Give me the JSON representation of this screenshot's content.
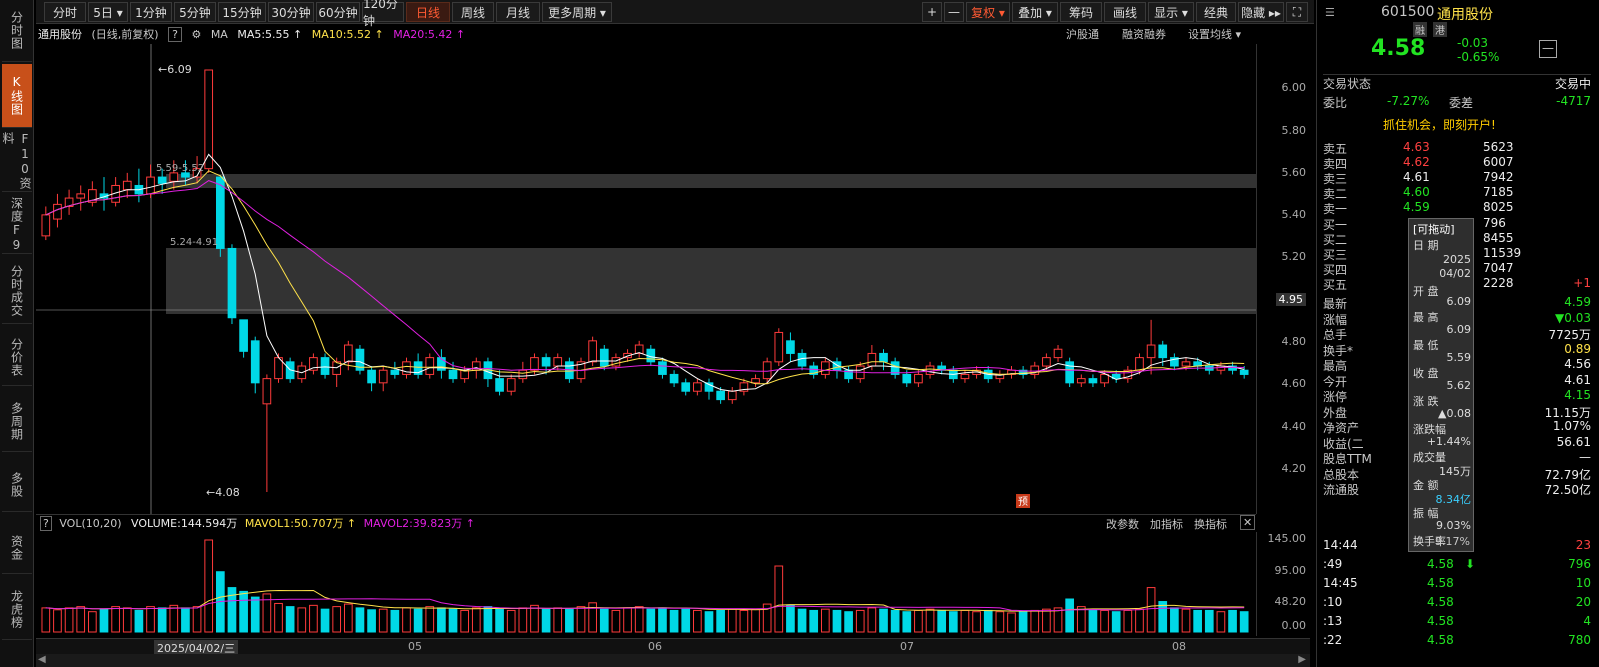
{
  "left_tabs": [
    "分时图",
    "K线图",
    "F10资料",
    "深度F9",
    "分时成交",
    "分价表",
    "多周期",
    "多股",
    "资金",
    "龙虎榜"
  ],
  "period_tabs": [
    {
      "label": "分时"
    },
    {
      "label": "5日 ▾"
    },
    {
      "label": "1分钟"
    },
    {
      "label": "5分钟"
    },
    {
      "label": "15分钟"
    },
    {
      "label": "30分钟"
    },
    {
      "label": "60分钟"
    },
    {
      "label": "120分钟"
    },
    {
      "label": "日线"
    },
    {
      "label": "周线"
    },
    {
      "label": "月线"
    },
    {
      "label": "更多周期 ▾"
    }
  ],
  "tools": [
    {
      "label": "+"
    },
    {
      "label": "—"
    },
    {
      "label": "复权 ▾"
    },
    {
      "label": "叠加 ▾"
    },
    {
      "label": "筹码"
    },
    {
      "label": "画线"
    },
    {
      "label": "显示 ▾"
    },
    {
      "label": "经典"
    },
    {
      "label": "隐藏 ▸▸"
    }
  ],
  "chart_header": {
    "name": "通用股份",
    "period": "(日线,前复权)",
    "help": "?",
    "ma_label": "MA",
    "ma5": "MA5:5.55 ↑",
    "ma10": "MA10:5.52 ↑",
    "ma20": "MA20:5.42 ↑",
    "link1": "沪股通",
    "link2": "融资融券",
    "link3": "设置均线 ▾"
  },
  "price_annotations": {
    "high": "6.09",
    "low": "4.08",
    "zone1": "5.59-5.52",
    "zone2": "5.24-4.91",
    "current": "4.95",
    "badge": "预"
  },
  "price_ticks": [
    "6.00",
    "5.80",
    "5.60",
    "5.40",
    "5.20",
    "5.00",
    "4.80",
    "4.60",
    "4.40",
    "4.20"
  ],
  "volume_header": {
    "vol": "VOL(10,20)",
    "volume": "VOLUME:144.594万",
    "mavol1": "MAVOL1:50.707万 ↑",
    "mavol2": "MAVOL2:39.823万 ↑",
    "b1": "改参数",
    "b2": "加指标",
    "b3": "换指标"
  },
  "volume_ticks": [
    "145.00",
    "95.00",
    "48.20",
    "0.00"
  ],
  "date_labels": [
    "2025/04/02/三",
    "05",
    "06",
    "07",
    "08"
  ],
  "colors": {
    "up": "#ff3b3b",
    "down": "#00d8e6",
    "ma5": "#ffffff",
    "ma10": "#ffe24a",
    "ma20": "#e020e0",
    "accent": "#ff5a33"
  },
  "chart_data": {
    "type": "candlestick",
    "ylim": [
      4.08,
      6.09
    ],
    "candles": [
      [
        5.3,
        5.4,
        5.28,
        5.44
      ],
      [
        5.38,
        5.45,
        5.34,
        5.5
      ],
      [
        5.44,
        5.48,
        5.4,
        5.52
      ],
      [
        5.48,
        5.5,
        5.42,
        5.54
      ],
      [
        5.46,
        5.52,
        5.44,
        5.56
      ],
      [
        5.5,
        5.48,
        5.42,
        5.58
      ],
      [
        5.46,
        5.54,
        5.44,
        5.58
      ],
      [
        5.52,
        5.56,
        5.48,
        5.6
      ],
      [
        5.54,
        5.5,
        5.46,
        5.62
      ],
      [
        5.5,
        5.58,
        5.48,
        5.64
      ],
      [
        5.58,
        5.55,
        5.5,
        5.62
      ],
      [
        5.56,
        5.6,
        5.52,
        5.66
      ],
      [
        5.6,
        5.58,
        5.54,
        5.66
      ],
      [
        5.58,
        5.62,
        5.55,
        5.68
      ],
      [
        5.62,
        6.09,
        5.6,
        6.09
      ],
      [
        5.58,
        5.24,
        5.2,
        5.59
      ],
      [
        5.24,
        4.91,
        4.88,
        5.26
      ],
      [
        4.9,
        4.75,
        4.72,
        4.9
      ],
      [
        4.8,
        4.6,
        4.55,
        4.82
      ],
      [
        4.5,
        4.62,
        4.08,
        4.64
      ],
      [
        4.62,
        4.72,
        4.6,
        4.74
      ],
      [
        4.7,
        4.62,
        4.6,
        4.72
      ],
      [
        4.62,
        4.68,
        4.6,
        4.7
      ],
      [
        4.66,
        4.72,
        4.64,
        4.74
      ],
      [
        4.72,
        4.64,
        4.62,
        4.74
      ],
      [
        4.64,
        4.7,
        4.58,
        4.72
      ],
      [
        4.7,
        4.78,
        4.66,
        4.8
      ],
      [
        4.76,
        4.66,
        4.64,
        4.78
      ],
      [
        4.66,
        4.6,
        4.56,
        4.68
      ],
      [
        4.6,
        4.66,
        4.56,
        4.68
      ],
      [
        4.66,
        4.64,
        4.62,
        4.7
      ],
      [
        4.64,
        4.7,
        4.62,
        4.72
      ],
      [
        4.7,
        4.64,
        4.62,
        4.74
      ],
      [
        4.64,
        4.72,
        4.62,
        4.74
      ],
      [
        4.72,
        4.66,
        4.62,
        4.76
      ],
      [
        4.66,
        4.62,
        4.6,
        4.7
      ],
      [
        4.62,
        4.66,
        4.6,
        4.68
      ],
      [
        4.66,
        4.7,
        4.62,
        4.72
      ],
      [
        4.7,
        4.62,
        4.58,
        4.72
      ],
      [
        4.62,
        4.56,
        4.54,
        4.66
      ],
      [
        4.56,
        4.62,
        4.54,
        4.64
      ],
      [
        4.62,
        4.66,
        4.6,
        4.7
      ],
      [
        4.66,
        4.72,
        4.64,
        4.74
      ],
      [
        4.72,
        4.68,
        4.64,
        4.74
      ],
      [
        4.68,
        4.72,
        4.66,
        4.74
      ],
      [
        4.7,
        4.62,
        4.6,
        4.72
      ],
      [
        4.62,
        4.7,
        4.6,
        4.72
      ],
      [
        4.7,
        4.8,
        4.68,
        4.82
      ],
      [
        4.76,
        4.68,
        4.66,
        4.78
      ],
      [
        4.68,
        4.72,
        4.66,
        4.74
      ],
      [
        4.72,
        4.74,
        4.7,
        4.76
      ],
      [
        4.74,
        4.78,
        4.72,
        4.8
      ],
      [
        4.76,
        4.7,
        4.68,
        4.78
      ],
      [
        4.7,
        4.64,
        4.62,
        4.72
      ],
      [
        4.64,
        4.6,
        4.58,
        4.66
      ],
      [
        4.6,
        4.56,
        4.54,
        4.62
      ],
      [
        4.56,
        4.6,
        4.54,
        4.62
      ],
      [
        4.6,
        4.56,
        4.52,
        4.62
      ],
      [
        4.56,
        4.52,
        4.5,
        4.58
      ],
      [
        4.52,
        4.56,
        4.5,
        4.58
      ],
      [
        4.56,
        4.6,
        4.54,
        4.62
      ],
      [
        4.6,
        4.62,
        4.58,
        4.64
      ],
      [
        4.62,
        4.7,
        4.6,
        4.72
      ],
      [
        4.7,
        4.84,
        4.68,
        4.86
      ],
      [
        4.8,
        4.74,
        4.7,
        4.84
      ],
      [
        4.74,
        4.68,
        4.66,
        4.76
      ],
      [
        4.68,
        4.64,
        4.62,
        4.7
      ],
      [
        4.64,
        4.7,
        4.62,
        4.72
      ],
      [
        4.7,
        4.66,
        4.62,
        4.72
      ],
      [
        4.66,
        4.62,
        4.6,
        4.68
      ],
      [
        4.62,
        4.68,
        4.6,
        4.7
      ],
      [
        4.68,
        4.74,
        4.66,
        4.78
      ],
      [
        4.74,
        4.7,
        4.66,
        4.76
      ],
      [
        4.7,
        4.64,
        4.62,
        4.72
      ],
      [
        4.64,
        4.6,
        4.58,
        4.66
      ],
      [
        4.6,
        4.64,
        4.58,
        4.66
      ],
      [
        4.64,
        4.68,
        4.62,
        4.7
      ],
      [
        4.68,
        4.66,
        4.64,
        4.7
      ],
      [
        4.66,
        4.62,
        4.6,
        4.68
      ],
      [
        4.62,
        4.64,
        4.6,
        4.66
      ],
      [
        4.64,
        4.66,
        4.62,
        4.68
      ],
      [
        4.66,
        4.62,
        4.6,
        4.68
      ],
      [
        4.62,
        4.64,
        4.6,
        4.66
      ],
      [
        4.64,
        4.66,
        4.62,
        4.68
      ],
      [
        4.66,
        4.64,
        4.62,
        4.68
      ],
      [
        4.64,
        4.68,
        4.62,
        4.7
      ],
      [
        4.68,
        4.72,
        4.66,
        4.74
      ],
      [
        4.72,
        4.76,
        4.7,
        4.78
      ],
      [
        4.7,
        4.6,
        4.58,
        4.72
      ],
      [
        4.6,
        4.62,
        4.58,
        4.64
      ],
      [
        4.62,
        4.6,
        4.58,
        4.64
      ],
      [
        4.6,
        4.64,
        4.58,
        4.66
      ],
      [
        4.64,
        4.62,
        4.6,
        4.66
      ],
      [
        4.62,
        4.66,
        4.6,
        4.68
      ],
      [
        4.66,
        4.72,
        4.64,
        4.74
      ],
      [
        4.72,
        4.78,
        4.64,
        4.9
      ],
      [
        4.78,
        4.72,
        4.68,
        4.8
      ],
      [
        4.72,
        4.68,
        4.66,
        4.74
      ],
      [
        4.68,
        4.7,
        4.66,
        4.72
      ],
      [
        4.7,
        4.68,
        4.66,
        4.72
      ],
      [
        4.68,
        4.66,
        4.64,
        4.7
      ],
      [
        4.66,
        4.68,
        4.64,
        4.7
      ],
      [
        4.68,
        4.66,
        4.64,
        4.7
      ],
      [
        4.66,
        4.64,
        4.62,
        4.68
      ]
    ],
    "volume": [
      38,
      35,
      38,
      40,
      32,
      36,
      40,
      38,
      34,
      40,
      38,
      42,
      38,
      40,
      145,
      95,
      70,
      64,
      55,
      60,
      45,
      40,
      38,
      42,
      36,
      40,
      44,
      38,
      35,
      36,
      34,
      38,
      36,
      40,
      38,
      36,
      34,
      38,
      40,
      36,
      34,
      38,
      42,
      36,
      38,
      36,
      40,
      46,
      36,
      34,
      38,
      40,
      36,
      38,
      34,
      36,
      34,
      32,
      34,
      36,
      34,
      36,
      44,
      104,
      42,
      36,
      34,
      36,
      34,
      32,
      34,
      38,
      36,
      34,
      32,
      34,
      36,
      34,
      32,
      34,
      32,
      34,
      32,
      30,
      32,
      34,
      36,
      38,
      52,
      40,
      36,
      34,
      32,
      34,
      36,
      70,
      48,
      38,
      36,
      34,
      34,
      32,
      34,
      32
    ]
  },
  "right_panel": {
    "code": "601500",
    "name": "通用股份",
    "tag1": "融",
    "tag2": "港",
    "price": "4.58",
    "change": "-0.03",
    "pct": "-0.65%",
    "status_label": "交易状态",
    "status_val": "交易中",
    "wb_label": "委比",
    "wb_val": "-7.27%",
    "wc_label": "委差",
    "wc_val": "-4717",
    "promo": "抓住机会，即刻开户!",
    "asks": [
      [
        "卖五",
        "4.63",
        "5623"
      ],
      [
        "卖四",
        "4.62",
        "6007"
      ],
      [
        "卖三",
        "4.61",
        "7942"
      ],
      [
        "卖二",
        "4.60",
        "7185"
      ],
      [
        "卖一",
        "4.59",
        "8025"
      ]
    ],
    "bids": [
      [
        "买一",
        "",
        "796"
      ],
      [
        "买二",
        "",
        "8455"
      ],
      [
        "买三",
        "",
        "11539"
      ],
      [
        "买四",
        "",
        "7047"
      ],
      [
        "买五",
        "",
        "2228",
        "+1"
      ]
    ],
    "stats": [
      [
        "最新",
        "4.59"
      ],
      [
        "涨幅",
        "▼0.03"
      ],
      [
        "总手",
        "7725万"
      ],
      [
        "换手*",
        "0.89"
      ],
      [
        "最高",
        "4.56"
      ],
      [
        "今开",
        "4.61"
      ],
      [
        "涨停",
        "4.15"
      ],
      [
        "外盘",
        "11.15万"
      ],
      [
        "净资产",
        "1.07%"
      ],
      [
        "收益(二",
        "56.61"
      ],
      [
        "股息TTM",
        "—"
      ],
      [
        "总股本",
        "72.79亿"
      ],
      [
        "流通股",
        "72.50亿"
      ]
    ],
    "ticks": [
      [
        "14:44",
        "",
        "",
        "23"
      ],
      [
        ":49",
        "4.58",
        "⬇",
        "796"
      ],
      [
        "14:45",
        "4.58",
        "",
        "10"
      ],
      [
        ":10",
        "4.58",
        "",
        "20"
      ],
      [
        ":13",
        "4.58",
        "",
        "4"
      ],
      [
        ":22",
        "4.58",
        "",
        "780"
      ]
    ]
  },
  "popup": {
    "title": "[可拖动]",
    "date_label": "日  期",
    "date1": "2025",
    "date2": "04/02",
    "open_label": "开  盘",
    "open": "6.09",
    "high_label": "最  高",
    "high": "6.09",
    "low_label": "最  低",
    "low": "5.59",
    "close_label": "收  盘",
    "close": "5.62",
    "chg_label": "涨  跌",
    "chg": "▲0.08",
    "pct_label": "涨跌幅",
    "pct": "+1.44%",
    "vol_label": "成交量",
    "vol": "145万",
    "amt_label": "金  额",
    "amt": "8.34亿",
    "amp_label": "振  幅",
    "amp": "9.03%",
    "turn_label": "换手率",
    "turn": "9.17%"
  }
}
